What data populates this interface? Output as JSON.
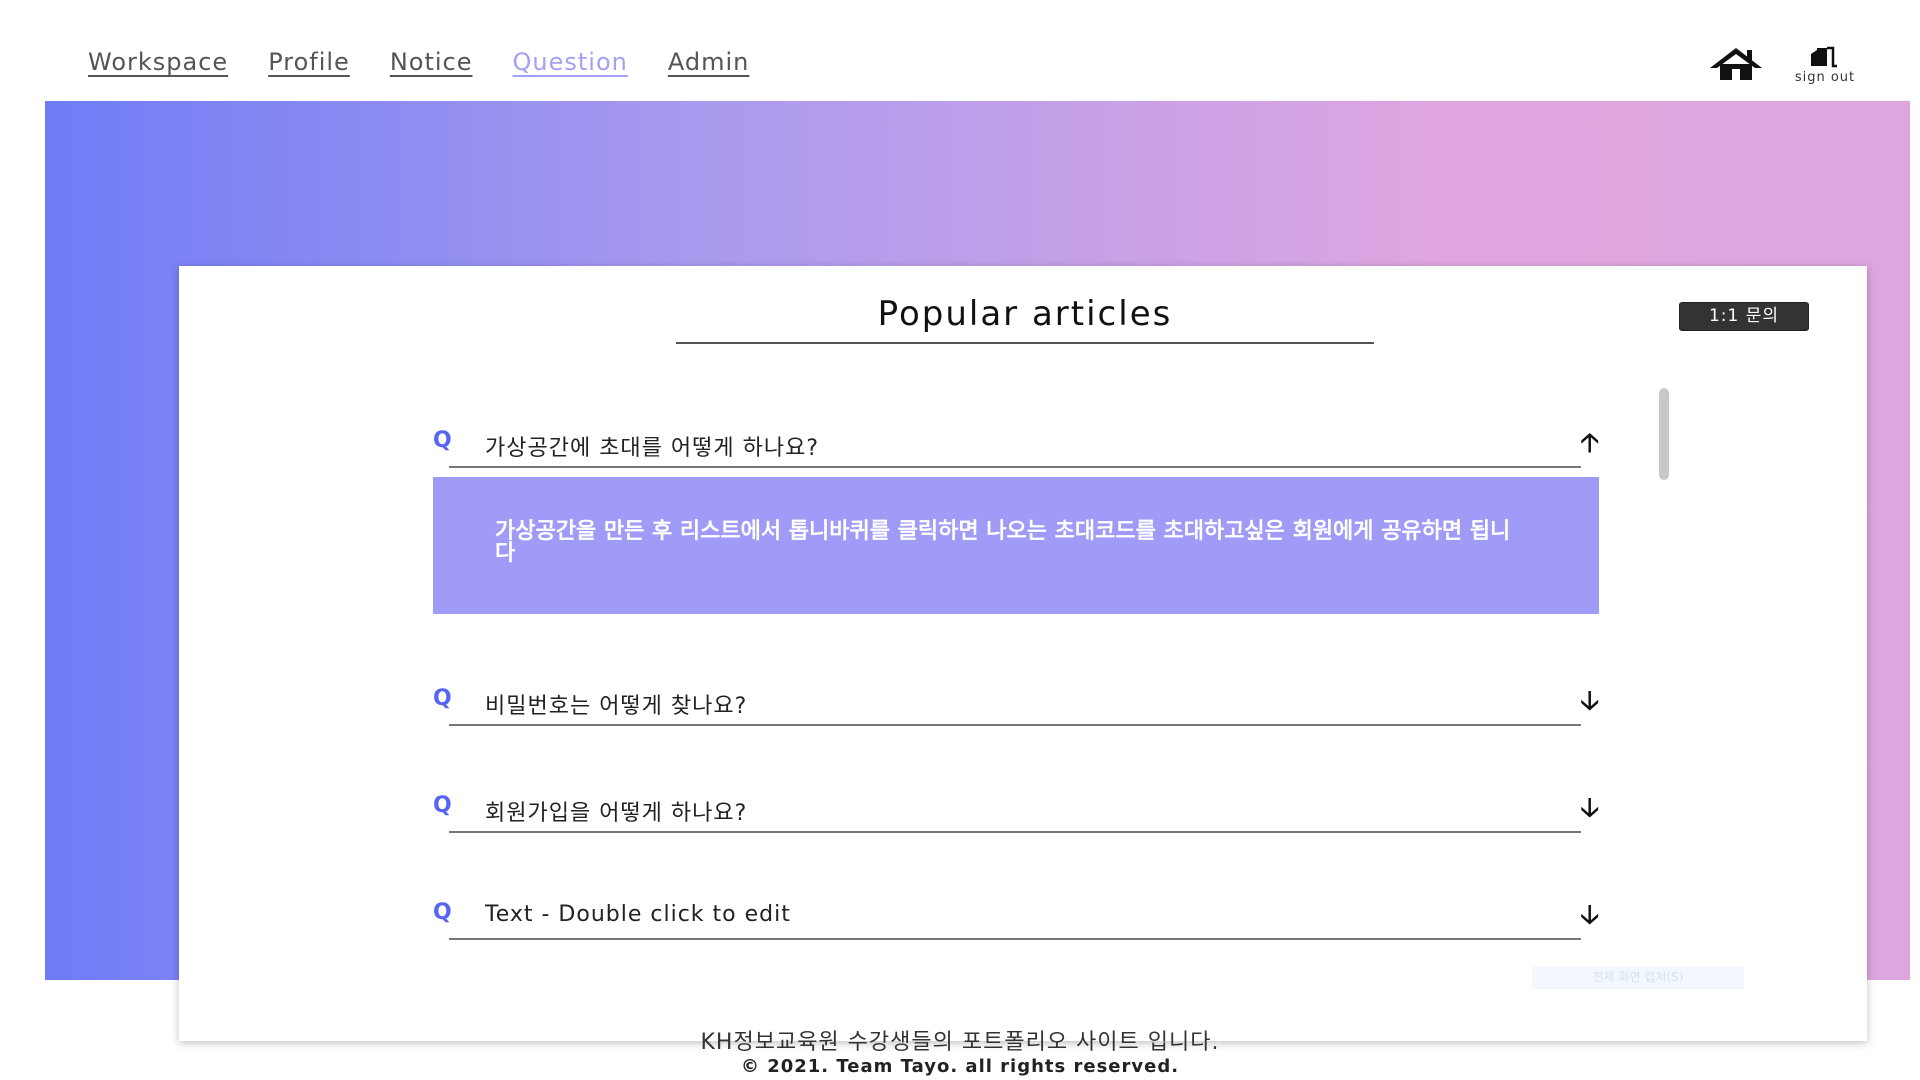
{
  "nav": {
    "items": [
      {
        "label": "Workspace"
      },
      {
        "label": "Profile"
      },
      {
        "label": "Notice"
      },
      {
        "label": "Question"
      },
      {
        "label": "Admin"
      }
    ],
    "active": "Question",
    "signout_label": "sign out"
  },
  "card": {
    "title": "Popular articles",
    "inquiry_button": "1:1 문의",
    "capture_hint": "전체 화면 캡처(S)"
  },
  "faq": [
    {
      "question": "가상공간에 초대를 어떻게 하나요?",
      "expanded": true,
      "answer": "가상공간을 만든 후 리스트에서 톱니바퀴를 클릭하면 나오는 초대코드를 초대하고싶은 회원에게 공유하면 됩니다"
    },
    {
      "question": "비밀번호는 어떻게 찾나요?",
      "expanded": false
    },
    {
      "question": "회원가입을 어떻게 하나요?",
      "expanded": false
    },
    {
      "question": "Text - Double click to edit",
      "expanded": false
    }
  ],
  "footer": {
    "line1": "KH정보교육원 수강생들의 포트폴리오 사이트 입니다.",
    "line2": "© 2021. Team Tayo. all rights reserved."
  },
  "colors": {
    "accent": "#a09bf7",
    "q_icon": "#5865f2",
    "gradient_start": "#6f7cf6",
    "gradient_end": "#dda6e0"
  },
  "icons": {
    "home": "home-icon",
    "signout": "sign-out-door-icon",
    "question": "q-icon",
    "expand": "arrow-down-icon",
    "collapse": "arrow-up-icon"
  }
}
